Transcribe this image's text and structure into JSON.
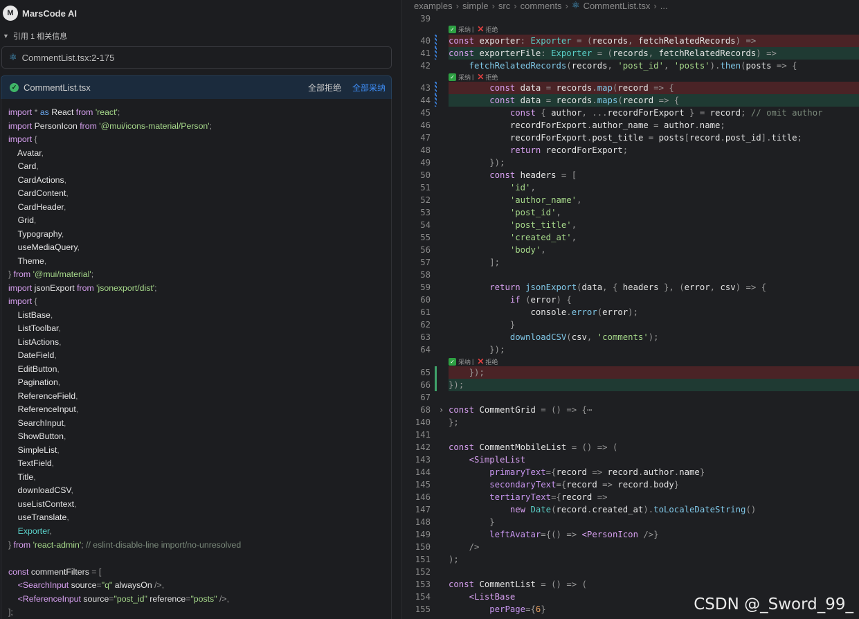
{
  "left_panel": {
    "brand": {
      "logo": "M",
      "name": "MarsCode AI"
    },
    "reference": {
      "text": "引用 1 相关信息"
    },
    "file_reference": {
      "label": "CommentList.tsx:2-175"
    },
    "card": {
      "file_name": "CommentList.tsx",
      "reject_all": "全部拒绝",
      "accept_all": "全部采纳",
      "lines": [
        "import * as React from 'react';",
        "import PersonIcon from '@mui/icons-material/Person';",
        "import {",
        "    Avatar,",
        "    Card,",
        "    CardActions,",
        "    CardContent,",
        "    CardHeader,",
        "    Grid,",
        "    Typography,",
        "    useMediaQuery,",
        "    Theme,",
        "} from '@mui/material';",
        "import jsonExport from 'jsonexport/dist';",
        "import {",
        "    ListBase,",
        "    ListToolbar,",
        "    ListActions,",
        "    DateField,",
        "    EditButton,",
        "    Pagination,",
        "    ReferenceField,",
        "    ReferenceInput,",
        "    SearchInput,",
        "    ShowButton,",
        "    SimpleList,",
        "    TextField,",
        "    Title,",
        "    downloadCSV,",
        "    useListContext,",
        "    useTranslate,",
        "    Exporter,",
        "} from 'react-admin'; // eslint-disable-line import/no-unresolved",
        "",
        "const commentFilters = [",
        "    <SearchInput source=\"q\" alwaysOn />,",
        "    <ReferenceInput source=\"post_id\" reference=\"posts\" />,",
        "];"
      ]
    }
  },
  "editor": {
    "breadcrumb": [
      "examples",
      "simple",
      "src",
      "comments",
      "CommentList.tsx",
      "..."
    ],
    "actions": {
      "accept": "采纳",
      "reject": "拒绝",
      "divider": "|"
    },
    "lines": [
      {
        "num": "39",
        "text": ""
      },
      {
        "num": "40",
        "text": "const exporter: Exporter = (records, fetchRelatedRecords) =>"
      },
      {
        "num": "41",
        "text": "const exporterFile: Exporter = (records, fetchRelatedRecords) =>"
      },
      {
        "num": "42",
        "text": "    fetchRelatedRecords(records, 'post_id', 'posts').then(posts => {"
      },
      {
        "num": "43",
        "text": "        const data = records.map(record => {"
      },
      {
        "num": "44",
        "text": "        const data = records.maps(record => {"
      },
      {
        "num": "45",
        "text": "            const { author, ...recordForExport } = record; // omit author"
      },
      {
        "num": "46",
        "text": "            recordForExport.author_name = author.name;"
      },
      {
        "num": "47",
        "text": "            recordForExport.post_title = posts[record.post_id].title;"
      },
      {
        "num": "48",
        "text": "            return recordForExport;"
      },
      {
        "num": "49",
        "text": "        });"
      },
      {
        "num": "50",
        "text": "        const headers = ["
      },
      {
        "num": "51",
        "text": "            'id',"
      },
      {
        "num": "52",
        "text": "            'author_name',"
      },
      {
        "num": "53",
        "text": "            'post_id',"
      },
      {
        "num": "54",
        "text": "            'post_title',"
      },
      {
        "num": "55",
        "text": "            'created_at',"
      },
      {
        "num": "56",
        "text": "            'body',"
      },
      {
        "num": "57",
        "text": "        ];"
      },
      {
        "num": "58",
        "text": ""
      },
      {
        "num": "59",
        "text": "        return jsonExport(data, { headers }, (error, csv) => {"
      },
      {
        "num": "60",
        "text": "            if (error) {"
      },
      {
        "num": "61",
        "text": "                console.error(error);"
      },
      {
        "num": "62",
        "text": "            }"
      },
      {
        "num": "63",
        "text": "            downloadCSV(csv, 'comments');"
      },
      {
        "num": "64",
        "text": "        });"
      },
      {
        "num": "65",
        "text": "    });"
      },
      {
        "num": "66",
        "text": "});"
      },
      {
        "num": "67",
        "text": ""
      },
      {
        "num": "68",
        "text": "const CommentGrid = () => {⋯"
      },
      {
        "num": "140",
        "text": "};"
      },
      {
        "num": "141",
        "text": ""
      },
      {
        "num": "142",
        "text": "const CommentMobileList = () => ("
      },
      {
        "num": "143",
        "text": "    <SimpleList"
      },
      {
        "num": "144",
        "text": "        primaryText={record => record.author.name}"
      },
      {
        "num": "145",
        "text": "        secondaryText={record => record.body}"
      },
      {
        "num": "146",
        "text": "        tertiaryText={record =>"
      },
      {
        "num": "147",
        "text": "            new Date(record.created_at).toLocaleDateString()"
      },
      {
        "num": "148",
        "text": "        }"
      },
      {
        "num": "149",
        "text": "        leftAvatar={() => <PersonIcon />}"
      },
      {
        "num": "150",
        "text": "    />"
      },
      {
        "num": "151",
        "text": ");"
      },
      {
        "num": "152",
        "text": ""
      },
      {
        "num": "153",
        "text": "const CommentList = () => ("
      },
      {
        "num": "154",
        "text": "    <ListBase"
      },
      {
        "num": "155",
        "text": "        perPage={6}"
      }
    ]
  },
  "watermark": "CSDN @_Sword_99_",
  "colors": {
    "accept_blue": "#3e8ef7",
    "deleted_bg": "#4a2326",
    "added_bg": "#1f3a33",
    "header_bg": "#1b2b3d"
  }
}
